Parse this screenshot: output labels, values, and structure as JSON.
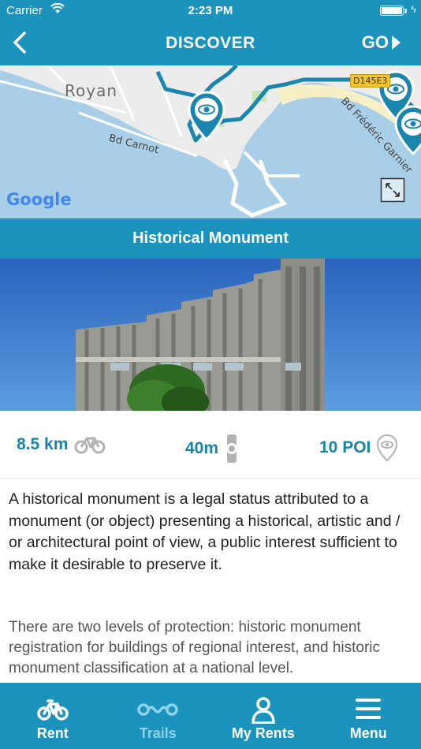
{
  "status_bar": {
    "carrier": "Carrier",
    "time": "2:23 PM"
  },
  "nav": {
    "title": "DISCOVER",
    "go_label": "GO"
  },
  "map": {
    "town_label": "Royan",
    "road_label_1": "Bd Carnot",
    "road_label_2": "Bd Frédéric Garnier",
    "route_badge": "D145E3",
    "provider": "Google"
  },
  "trail": {
    "title": "Historical Monument",
    "distance": "8.5 km",
    "duration": "40m",
    "poi_count": "10 POI",
    "description": "A historical monument is a legal status attributed to a monument (or object) presenting a historical, artistic and / or architectural point of view, a public interest sufficient to make it desirable to preserve it.",
    "description_2": "There are two levels of protection: historic monument registration for buildings of regional interest, and historic monument classification at a national level."
  },
  "tabbar": {
    "items": [
      {
        "label": "Rent",
        "icon": "bike-icon",
        "active": true
      },
      {
        "label": "Trails",
        "icon": "trail-icon",
        "active": false
      },
      {
        "label": "My Rents",
        "icon": "user-icon",
        "active": true
      },
      {
        "label": "Menu",
        "icon": "menu-icon",
        "active": true
      }
    ]
  },
  "colors": {
    "primary": "#1b93bd",
    "stat_text": "#1b83a8",
    "inactive_tab": "#8fd3ea",
    "map_water": "#a9cfe8",
    "map_land": "#ececec",
    "route": "#1a86ad"
  }
}
